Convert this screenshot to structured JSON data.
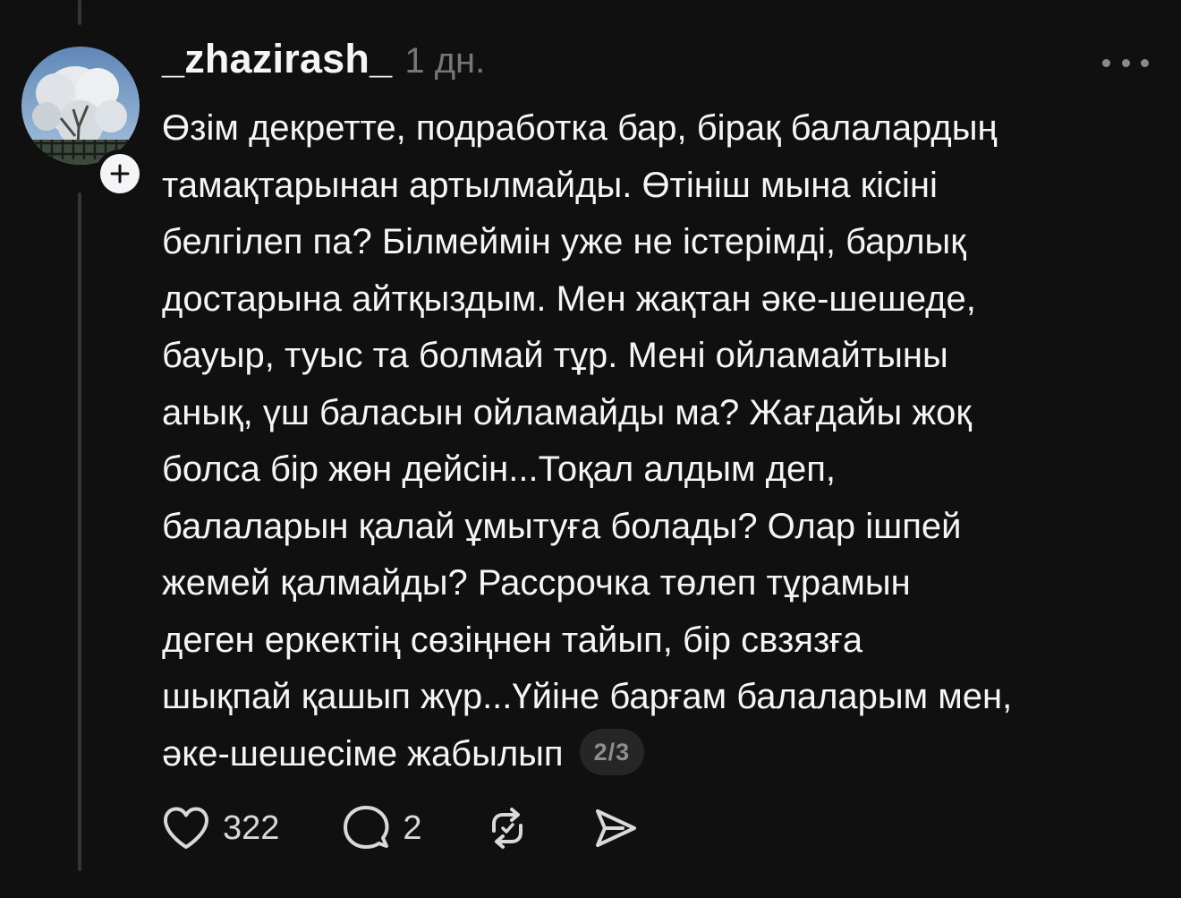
{
  "post": {
    "username": "_zhazirash_",
    "time": "1 дн.",
    "lines": [
      "Өзім декретте, подработка бар, бірақ балалардың",
      "тамақтарынан артылмайды. Өтініш мына кісіні",
      "белгілеп па? Білмеймін уже не істерімді, барлық",
      "достарына айтқыздым. Мен жақтан әке-шешеде,",
      "бауыр, туыс та болмай тұр. Мені ойламайтыны",
      "анық, үш баласын ойламайды ма? Жағдайы жоқ",
      "болса бір жөн дейсін...Тоқал алдым деп,",
      "балаларын қалай ұмытуға болады? Олар ішпей",
      "жемей қалмайды? Рассрочка төлеп тұрамын",
      "деген еркектің сөзіңнен тайып, бір свзязға",
      "шықпай қашып жүр...Үйіне барғам балаларым мен,",
      "әке-шешесіме жабылып"
    ],
    "page_indicator": "2/3"
  },
  "actions": {
    "likes": "322",
    "comments": "2"
  },
  "icons": {
    "more": "more-horizontal-icon",
    "follow": "plus-icon",
    "like": "heart-icon",
    "comment": "comment-bubble-icon",
    "repost": "repost-icon",
    "share": "send-icon"
  },
  "colors": {
    "background": "#101010",
    "text": "#f3f5f7",
    "muted": "#777777",
    "thread_line": "#333638",
    "badge_bg": "#262626"
  }
}
